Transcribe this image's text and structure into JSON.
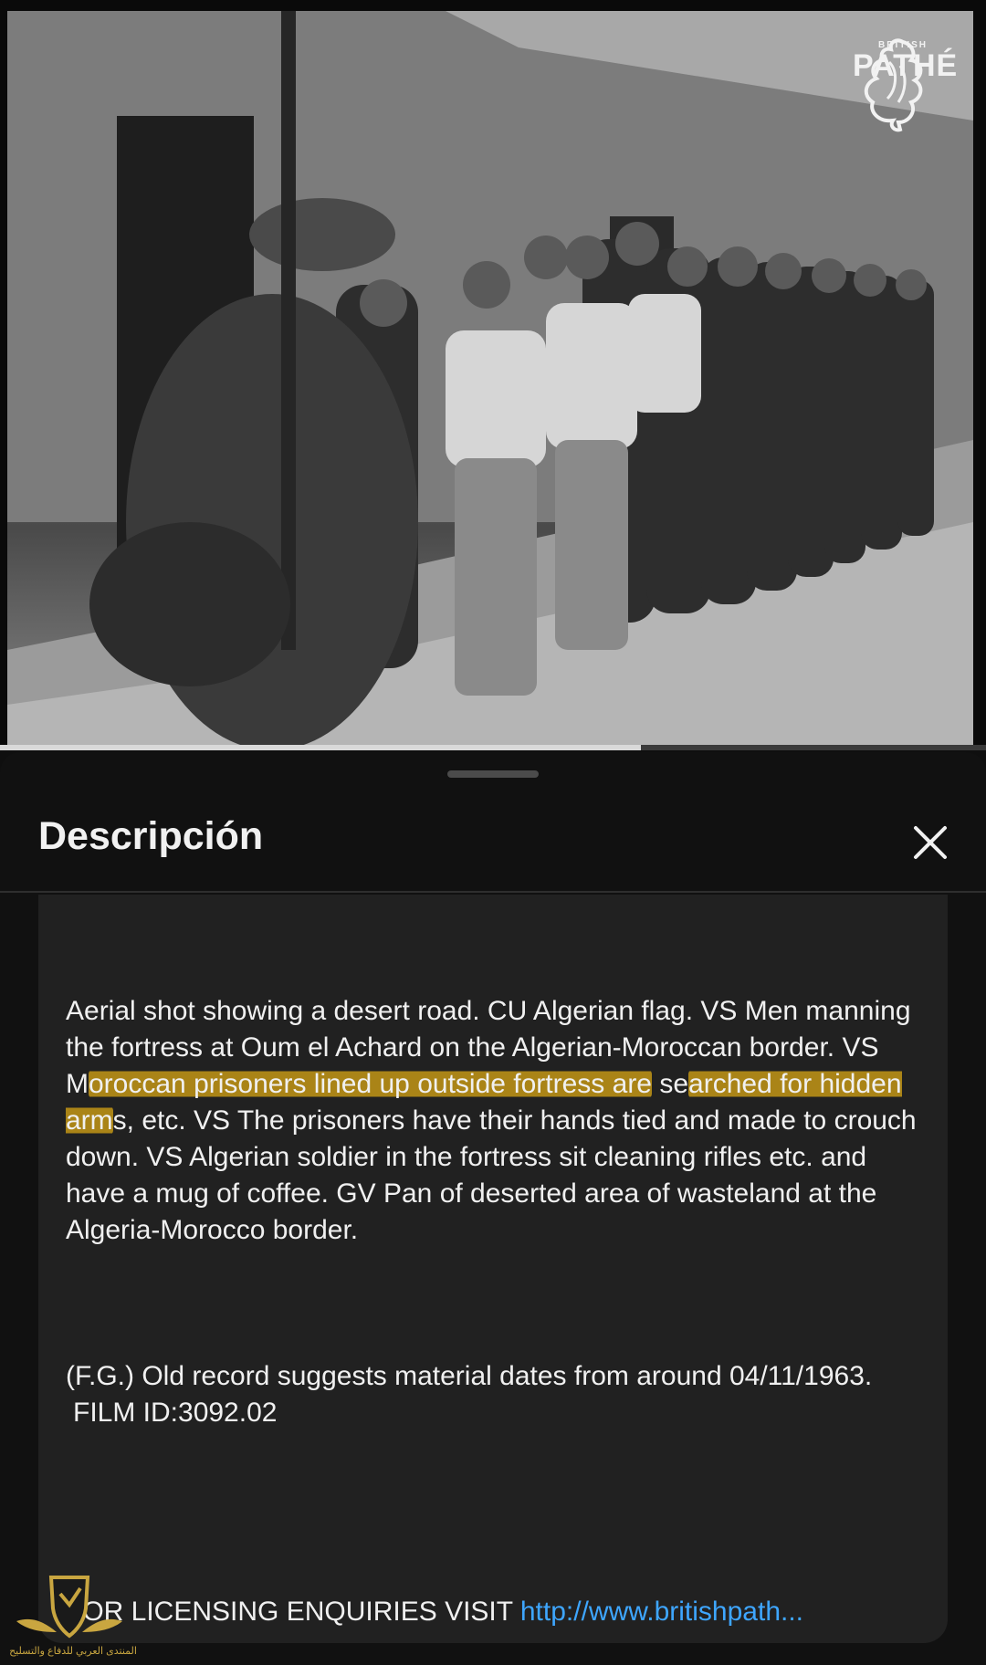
{
  "video": {
    "channel_logo": {
      "top_label": "BRITISH",
      "name": "PATHÉ",
      "icon": "rooster-icon"
    },
    "progress_fraction": 0.65
  },
  "sheet": {
    "title": "Descripción",
    "close_icon": "close-icon",
    "description": {
      "part1": "Aerial shot showing a desert road. CU Algerian flag. VS Men manning the fortress at Oum el Achard on the Algerian-Moroccan border. VS M",
      "highlight1": "oroccan prisoners lined up outside fortress are",
      "part2": " se",
      "highlight2": "arched for hidden arm",
      "part3": "s, etc. VS The prisoners have their hands tied and made to crouch down. VS Algerian soldier in the fortress sit cleaning rifles etc. and have a mug of coffee. GV Pan of deserted area of wasteland at the Algeria-Morocco border."
    },
    "note": {
      "line": "(F.G.) Old record suggests material dates from around 04/11/1963.",
      "film_id": "FILM ID:3092.02"
    },
    "licensing": {
      "label": "FOR LICENSING ENQUIRIES VISIT ",
      "link": "http://www.britishpath..."
    }
  },
  "watermark": {
    "text": "المنتدى العربي للدفاع والتسليح",
    "icon": "shield-wings-icon",
    "accent": "#c9a640"
  },
  "colors": {
    "background": "#0f0f0f",
    "card": "#212121",
    "highlight": "#d0a014",
    "link": "#3ea6ff"
  }
}
